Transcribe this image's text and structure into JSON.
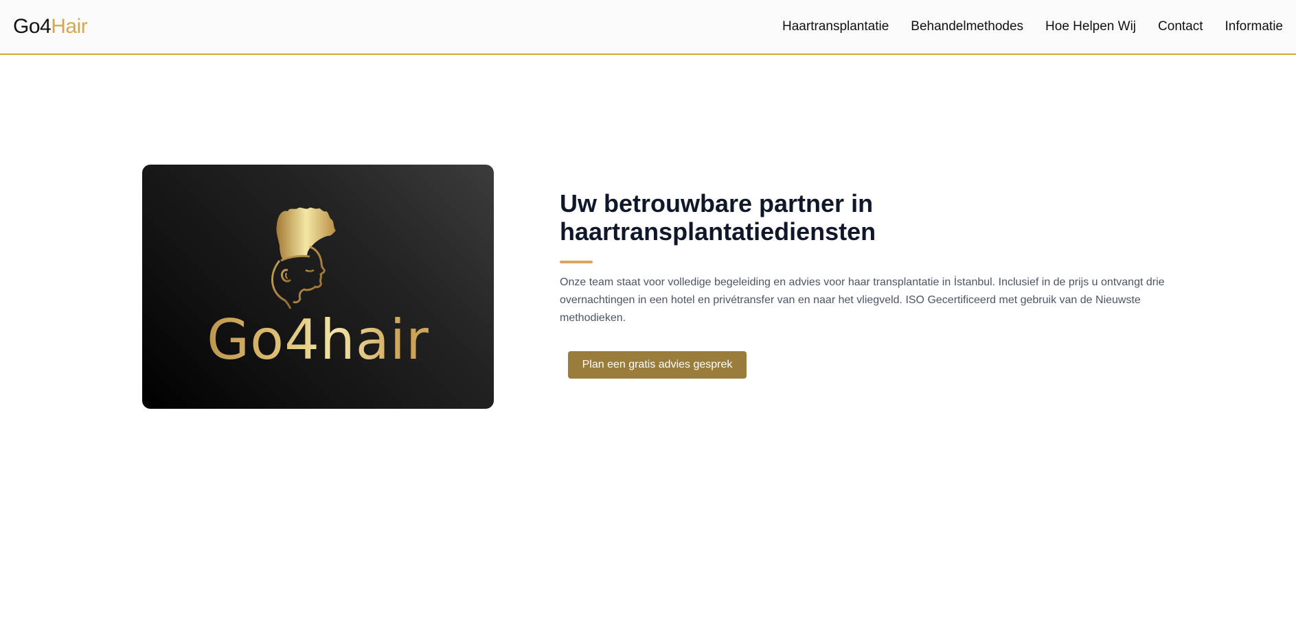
{
  "brand": {
    "part1": "Go4",
    "part2": "Hair"
  },
  "nav": {
    "items": [
      {
        "label": "Haartransplantatie"
      },
      {
        "label": "Behandelmethodes"
      },
      {
        "label": "Hoe Helpen Wij"
      },
      {
        "label": "Contact"
      },
      {
        "label": "Informatie"
      }
    ]
  },
  "hero": {
    "logo_text": "Go4hair",
    "heading": "Uw betrouwbare partner in haartransplantatiediensten",
    "description": "Onze team staat voor volledige begeleiding en advies voor haar transplantatie in İstanbul. Inclusief in de prijs u ontvangt drie overnachtingen in een hotel en privétransfer van en naar het vliegveld. ISO Gecertificeerd met gebruik van de Nieuwste methodieken.",
    "cta_label": "Plan een gratis advies gesprek"
  },
  "colors": {
    "accent": "#d4a82c",
    "brand_gold": "#d2a850",
    "button": "#9a7d3b",
    "divider": "#dba65c"
  },
  "icons": {
    "logo_emblem": "head-silhouette-icon"
  }
}
